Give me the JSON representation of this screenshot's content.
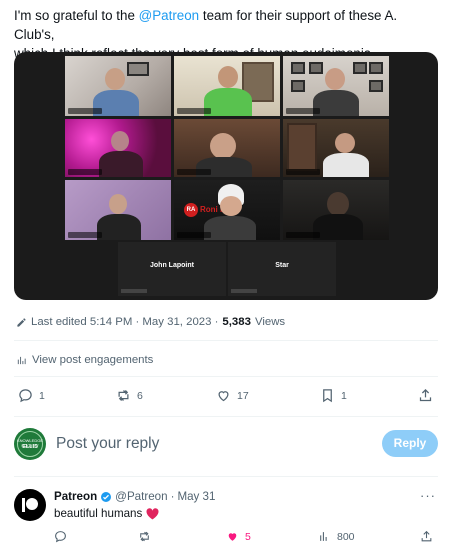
{
  "post": {
    "text_line1_pre": "I'm so grateful to the ",
    "mention": "@Patreon",
    "text_line1_post": " team for their support of these A. Club's,",
    "text_line2": "which I think reflect the very best form of human eudaimonia."
  },
  "media": {
    "participant_names": [
      "John Lapoint",
      "Star"
    ],
    "logo_badge": "RA",
    "logo_text": "Roni     ive"
  },
  "meta": {
    "edited_label": "Last edited 5:14 PM · May 31, 2023 · ",
    "views_count": "5,383",
    "views_label": " Views"
  },
  "engagements_label": "View post engagements",
  "actions": {
    "replies": "1",
    "reposts": "6",
    "likes": "17",
    "bookmarks": "1"
  },
  "reply_box": {
    "avatar_top": "KNOWLEDGE SOCIETY",
    "avatar_main": "ELLIS",
    "placeholder": "Post your reply",
    "button": "Reply"
  },
  "reply_post": {
    "name": "Patreon",
    "handle": "@Patreon",
    "separator": "·",
    "date": "May 31",
    "more": "···",
    "text": "beautiful humans",
    "likes": "5",
    "views": "800"
  },
  "colors": {
    "accent": "#1d9bf0",
    "like": "#f91880",
    "reply_button": "#8ecdf8",
    "muted": "#536471"
  },
  "icons": [
    "edit-icon",
    "analytics-icon",
    "reply-icon",
    "repost-icon",
    "like-icon",
    "bookmark-icon",
    "share-icon",
    "verified-icon",
    "heart-emoji-icon",
    "views-icon"
  ]
}
